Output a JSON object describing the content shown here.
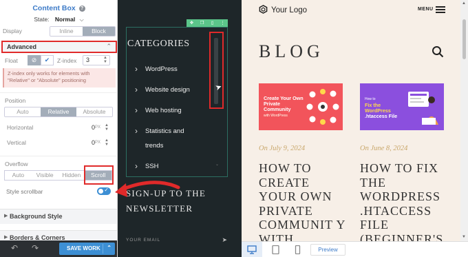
{
  "panel": {
    "title": "Content Box",
    "help": "?",
    "state_label": "State:",
    "state_value": "Normal",
    "display_label": "Display",
    "display_options": [
      "Inline",
      "Block"
    ],
    "display_selected": "Block",
    "advanced_label": "Advanced",
    "float_label": "Float",
    "zindex_label": "Z-index",
    "zindex_value": "3",
    "zindex_note": "Z-index only works for elements with \"Relative\" or \"Absolute\" positioning",
    "position_label": "Position",
    "position_options": [
      "Auto",
      "Relative",
      "Absolute"
    ],
    "position_selected": "Relative",
    "horizontal_label": "Horizontal",
    "horizontal_value": "0",
    "vertical_label": "Vertical",
    "vertical_value": "0",
    "unit": "PX",
    "overflow_label": "Overflow",
    "overflow_options": [
      "Auto",
      "Visible",
      "Hidden",
      "Scroll"
    ],
    "overflow_selected": "Scroll",
    "style_scrollbar_label": "Style scrollbar",
    "style_scrollbar_on": true,
    "accordion": [
      "Background Style",
      "Borders & Corners"
    ],
    "save_label": "SAVE WORK"
  },
  "dark_preview": {
    "categories_title": "CATEGORIES",
    "categories": [
      "WordPress",
      "Website design",
      "Web hosting",
      "Statistics and",
      "trends",
      "SSH"
    ],
    "newsletter_line1": "SIGN-UP TO THE",
    "newsletter_line2": "NEWSLETTER",
    "email_placeholder": "YOUR EMAIL"
  },
  "blog_preview": {
    "logo": "Your Logo",
    "menu_label": "MENU",
    "blog_title": "BLOG",
    "posts": [
      {
        "thumb_title": "Create Your Own Private Community",
        "thumb_sub": "with WordPress",
        "date": "On July 9, 2024",
        "title": "HOW TO CREATE YOUR OWN PRIVATE COMMUNIT Y WITH"
      },
      {
        "thumb_pre": "How to",
        "thumb_title_a": "Fix the WordPress",
        "thumb_title_b": ".htaccess File",
        "date": "On June 8, 2024",
        "title": "HOW TO FIX THE WORDPRESS .HTACCESS FILE (BEGINNER'S"
      }
    ],
    "preview_label": "Preview"
  },
  "colors": {
    "accent": "#3d8fd4",
    "highlight": "#e02a2a",
    "dark_bg": "#1e2629",
    "blog_bg": "#f7efe7",
    "thumb1": "#f2545b",
    "thumb2": "#8b4fde"
  },
  "icons": [
    "help-icon",
    "chevron-down-icon",
    "chevron-up-icon",
    "ban-icon",
    "check-icon",
    "undo-icon",
    "redo-icon",
    "move-icon",
    "duplicate-icon",
    "delete-icon",
    "more-icon",
    "send-icon",
    "logo-icon",
    "hamburger-icon",
    "search-icon",
    "desktop-icon",
    "tablet-icon",
    "mobile-icon"
  ]
}
